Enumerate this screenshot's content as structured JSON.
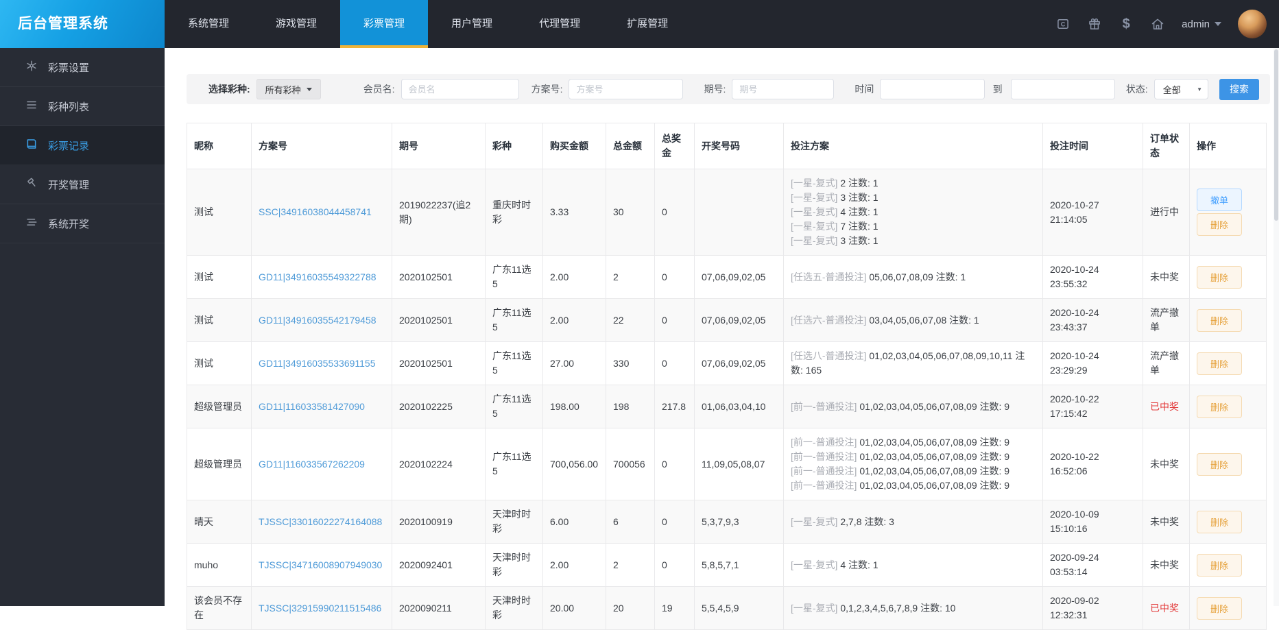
{
  "app": {
    "title": "后台管理系统"
  },
  "topnav": {
    "items": [
      {
        "label": "系统管理",
        "active": false
      },
      {
        "label": "游戏管理",
        "active": false
      },
      {
        "label": "彩票管理",
        "active": true
      },
      {
        "label": "用户管理",
        "active": false
      },
      {
        "label": "代理管理",
        "active": false
      },
      {
        "label": "扩展管理",
        "active": false
      }
    ],
    "icons": [
      {
        "name": "clear-cache-icon"
      },
      {
        "name": "gift-icon"
      },
      {
        "name": "dollar-icon",
        "glyph": "$"
      },
      {
        "name": "home-icon"
      }
    ],
    "user": "admin"
  },
  "sidebar": {
    "items": [
      {
        "icon": "settings",
        "label": "彩票设置",
        "active": false
      },
      {
        "icon": "list",
        "label": "彩种列表",
        "active": false
      },
      {
        "icon": "book",
        "label": "彩票记录",
        "active": true
      },
      {
        "icon": "gavel",
        "label": "开奖管理",
        "active": false
      },
      {
        "icon": "layers",
        "label": "系统开奖",
        "active": false
      }
    ]
  },
  "filters": {
    "lottery_label": "选择彩种:",
    "lottery_value": "所有彩种",
    "member_label": "会员名:",
    "member_placeholder": "会员名",
    "plan_label": "方案号:",
    "plan_placeholder": "方案号",
    "issue_label": "期号:",
    "issue_placeholder": "期号",
    "time_label": "时间",
    "time_from_value": "",
    "to_label": "到",
    "time_to_value": "",
    "status_label": "状态:",
    "status_value": "全部",
    "search_label": "搜索"
  },
  "table": {
    "columns": [
      "昵称",
      "方案号",
      "期号",
      "彩种",
      "购买金额",
      "总金额",
      "总奖金",
      "开奖号码",
      "投注方案",
      "投注时间",
      "订单状态",
      "操作"
    ],
    "rows": [
      {
        "nickname": "测试",
        "plan_no": "SSC|34916038044458741",
        "issue": "2019022237(追2期)",
        "lottery": "重庆时时彩",
        "buy_amount": "3.33",
        "total_amount": "30",
        "total_prize": "0",
        "draw_numbers": "",
        "bet_plans": [
          "[一星-复式] 2 注数: 1",
          "[一星-复式] 3 注数: 1",
          "[一星-复式] 4 注数: 1",
          "[一星-复式] 7 注数: 1",
          "[一星-复式] 3 注数: 1"
        ],
        "bet_time": "2020-10-27 21:14:05",
        "status": "进行中",
        "status_win": false,
        "actions": [
          {
            "label": "撤单",
            "style": "primary"
          },
          {
            "label": "删除",
            "style": "warning"
          }
        ]
      },
      {
        "nickname": "测试",
        "plan_no": "GD11|34916035549322788",
        "issue": "2020102501",
        "lottery": "广东11选5",
        "buy_amount": "2.00",
        "total_amount": "2",
        "total_prize": "0",
        "draw_numbers": "07,06,09,02,05",
        "bet_plans": [
          "[任选五-普通投注] 05,06,07,08,09 注数: 1"
        ],
        "bet_time": "2020-10-24 23:55:32",
        "status": "未中奖",
        "status_win": false,
        "actions": [
          {
            "label": "删除",
            "style": "warning"
          }
        ]
      },
      {
        "nickname": "测试",
        "plan_no": "GD11|34916035542179458",
        "issue": "2020102501",
        "lottery": "广东11选5",
        "buy_amount": "2.00",
        "total_amount": "22",
        "total_prize": "0",
        "draw_numbers": "07,06,09,02,05",
        "bet_plans": [
          "[任选六-普通投注] 03,04,05,06,07,08 注数: 1"
        ],
        "bet_time": "2020-10-24 23:43:37",
        "status": "流产撤单",
        "status_win": false,
        "actions": [
          {
            "label": "删除",
            "style": "warning"
          }
        ]
      },
      {
        "nickname": "测试",
        "plan_no": "GD11|34916035533691155",
        "issue": "2020102501",
        "lottery": "广东11选5",
        "buy_amount": "27.00",
        "total_amount": "330",
        "total_prize": "0",
        "draw_numbers": "07,06,09,02,05",
        "bet_plans": [
          "[任选八-普通投注] 01,02,03,04,05,06,07,08,09,10,11 注数: 165"
        ],
        "bet_time": "2020-10-24 23:29:29",
        "status": "流产撤单",
        "status_win": false,
        "actions": [
          {
            "label": "删除",
            "style": "warning"
          }
        ]
      },
      {
        "nickname": "超级管理员",
        "plan_no": "GD11|116033581427090",
        "issue": "2020102225",
        "lottery": "广东11选5",
        "buy_amount": "198.00",
        "total_amount": "198",
        "total_prize": "217.8",
        "draw_numbers": "01,06,03,04,10",
        "bet_plans": [
          "[前一-普通投注] 01,02,03,04,05,06,07,08,09 注数: 9"
        ],
        "bet_time": "2020-10-22 17:15:42",
        "status": "已中奖",
        "status_win": true,
        "actions": [
          {
            "label": "删除",
            "style": "warning"
          }
        ]
      },
      {
        "nickname": "超级管理员",
        "plan_no": "GD11|116033567262209",
        "issue": "2020102224",
        "lottery": "广东11选5",
        "buy_amount": "700,056.00",
        "total_amount": "700056",
        "total_prize": "0",
        "draw_numbers": "11,09,05,08,07",
        "bet_plans": [
          "[前一-普通投注] 01,02,03,04,05,06,07,08,09 注数: 9",
          "[前一-普通投注] 01,02,03,04,05,06,07,08,09 注数: 9",
          "[前一-普通投注] 01,02,03,04,05,06,07,08,09 注数: 9",
          "[前一-普通投注] 01,02,03,04,05,06,07,08,09 注数: 9"
        ],
        "bet_time": "2020-10-22 16:52:06",
        "status": "未中奖",
        "status_win": false,
        "actions": [
          {
            "label": "删除",
            "style": "warning"
          }
        ]
      },
      {
        "nickname": "晴天",
        "plan_no": "TJSSC|33016022274164088",
        "issue": "2020100919",
        "lottery": "天津时时彩",
        "buy_amount": "6.00",
        "total_amount": "6",
        "total_prize": "0",
        "draw_numbers": "5,3,7,9,3",
        "bet_plans": [
          "[一星-复式] 2,7,8 注数: 3"
        ],
        "bet_time": "2020-10-09 15:10:16",
        "status": "未中奖",
        "status_win": false,
        "actions": [
          {
            "label": "删除",
            "style": "warning"
          }
        ]
      },
      {
        "nickname": "muho",
        "plan_no": "TJSSC|34716008907949030",
        "issue": "2020092401",
        "lottery": "天津时时彩",
        "buy_amount": "2.00",
        "total_amount": "2",
        "total_prize": "0",
        "draw_numbers": "5,8,5,7,1",
        "bet_plans": [
          "[一星-复式] 4 注数: 1"
        ],
        "bet_time": "2020-09-24 03:53:14",
        "status": "未中奖",
        "status_win": false,
        "actions": [
          {
            "label": "删除",
            "style": "warning"
          }
        ]
      },
      {
        "nickname": "该会员不存在",
        "plan_no": "TJSSC|32915990211515486",
        "issue": "2020090211",
        "lottery": "天津时时彩",
        "buy_amount": "20.00",
        "total_amount": "20",
        "total_prize": "19",
        "draw_numbers": "5,5,4,5,9",
        "bet_plans": [
          "[一星-复式] 0,1,2,3,4,5,6,7,8,9 注数: 10"
        ],
        "bet_time": "2020-09-02 12:32:31",
        "status": "已中奖",
        "status_win": true,
        "actions": [
          {
            "label": "删除",
            "style": "warning"
          }
        ]
      }
    ]
  },
  "colors": {
    "topbar_bg": "#23262e",
    "sidebar_bg": "#282c35",
    "logo_blue": "#15a0e4",
    "active_tab_blue": "#1292d8",
    "tab_underline_yellow": "#eeb338",
    "link_blue": "#4f9bd8",
    "win_red": "#e23636",
    "search_btn_blue": "#3d94e6",
    "cancel_btn_blue": "#409eff",
    "delete_btn_orange": "#e6a23c"
  }
}
